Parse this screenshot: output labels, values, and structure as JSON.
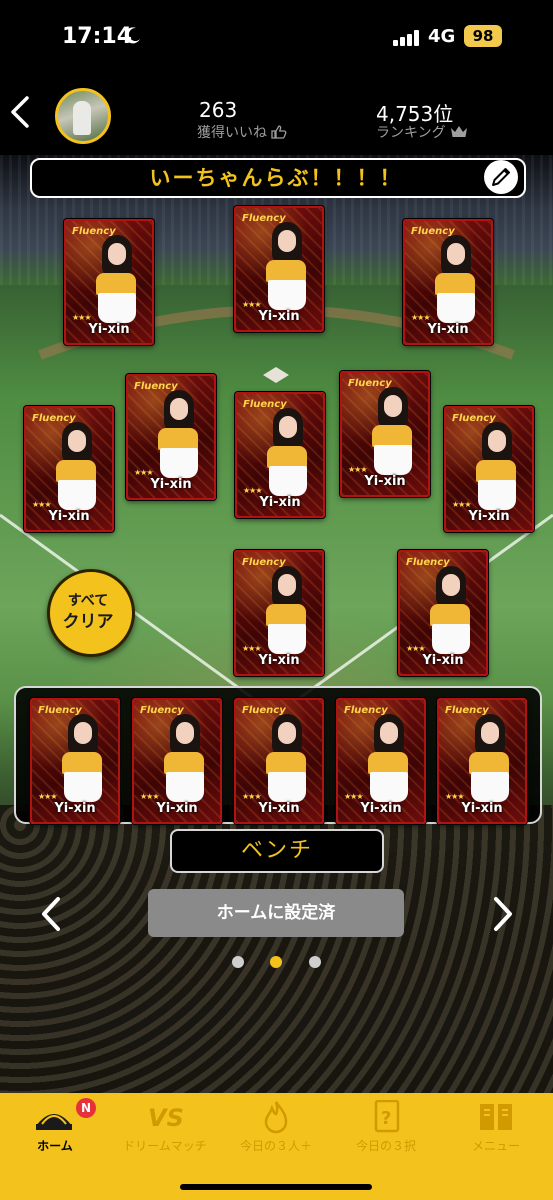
{
  "status_bar": {
    "time": "17:14",
    "network": "4G",
    "battery": "98"
  },
  "header": {
    "likes_count": "263",
    "likes_label": "獲得いいね",
    "rank_value": "4,753位",
    "rank_label": "ランキング"
  },
  "lineup": {
    "title": "いーちゃんらぶ！！！！",
    "clear_button": {
      "line1": "すべて",
      "line2": "クリア"
    },
    "card_brand": "Fluency",
    "card_stars": "★★★",
    "player_name": "Yi-xin",
    "bench_label": "ベンチ"
  },
  "actions": {
    "set_home_label": "ホームに設定済"
  },
  "pagination": {
    "total": 3,
    "active": 2
  },
  "tabbar": {
    "items": [
      {
        "label": "ホーム",
        "icon": "stadium-icon",
        "active": true,
        "badge": "N"
      },
      {
        "label": "ドリームマッチ",
        "icon": "vs-icon",
        "active": false
      },
      {
        "label": "今日の３人＋",
        "icon": "flame-icon",
        "active": false
      },
      {
        "label": "今日の３択",
        "icon": "question-card-icon",
        "active": false
      },
      {
        "label": "メニュー",
        "icon": "book-icon",
        "active": false
      }
    ]
  },
  "colors": {
    "accent": "#f4c21c",
    "badge": "#e8303a",
    "card": "#7a0f0f"
  }
}
